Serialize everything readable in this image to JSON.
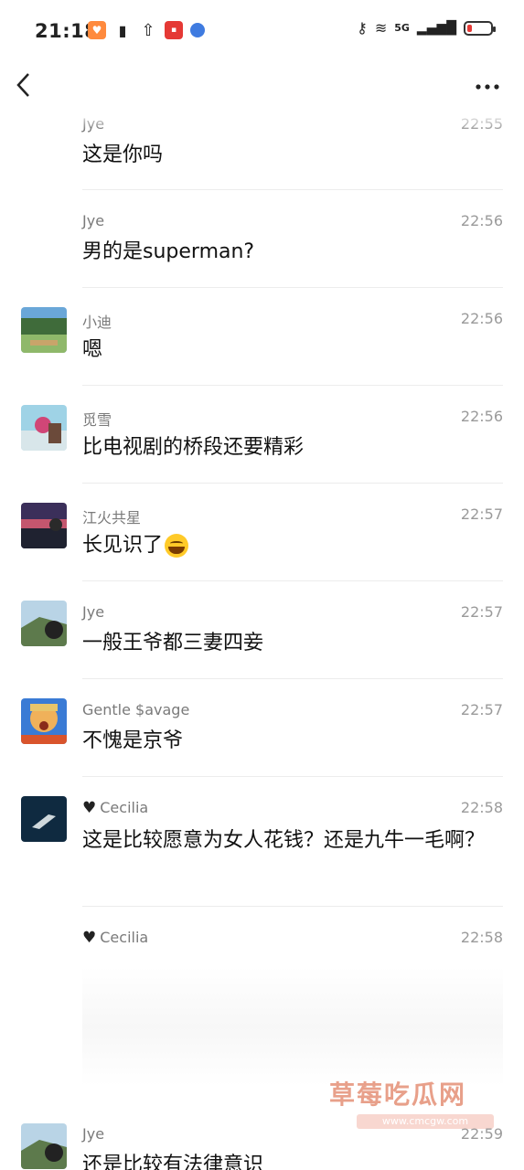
{
  "status_bar": {
    "time": "21:18",
    "network": "5G"
  },
  "header": {
    "back_icon": "chevron-left-icon",
    "more_icon": "more-horizontal-icon"
  },
  "messages": [
    {
      "name": "Jye",
      "time": "22:55",
      "text": "这是你吗",
      "avatar": false
    },
    {
      "name": "Jye",
      "time": "22:56",
      "text": "男的是superman?",
      "avatar": false
    },
    {
      "name": "小迪",
      "time": "22:56",
      "text": "嗯",
      "avatar": true
    },
    {
      "name": "觅雪",
      "time": "22:56",
      "text": "比电视剧的桥段还要精彩",
      "avatar": true
    },
    {
      "name": "江火共星",
      "time": "22:57",
      "text": "长见识了",
      "avatar": true
    },
    {
      "name": "Jye",
      "time": "22:57",
      "text": "一般王爷都三妻四妾",
      "avatar": true
    },
    {
      "name": "Gentle $avage",
      "time": "22:57",
      "text": "不愧是京爷",
      "avatar": true
    },
    {
      "name": "Cecilia",
      "time": "22:58",
      "text": "这是比较愿意为女人花钱？还是九牛一毛啊？",
      "avatar": true
    },
    {
      "name": "Cecilia",
      "time": "22:58",
      "text": "",
      "avatar": false
    },
    {
      "name": "Jye",
      "time": "22:59",
      "text": "还是比较有法律意识",
      "avatar": true
    }
  ],
  "watermark": {
    "title": "草莓吃瓜网",
    "url": "www.cmcgw.com"
  },
  "colors": {
    "battery_low": "#e53935",
    "name_gray": "#7a7a7a",
    "time_gray": "#9a9a9a"
  }
}
